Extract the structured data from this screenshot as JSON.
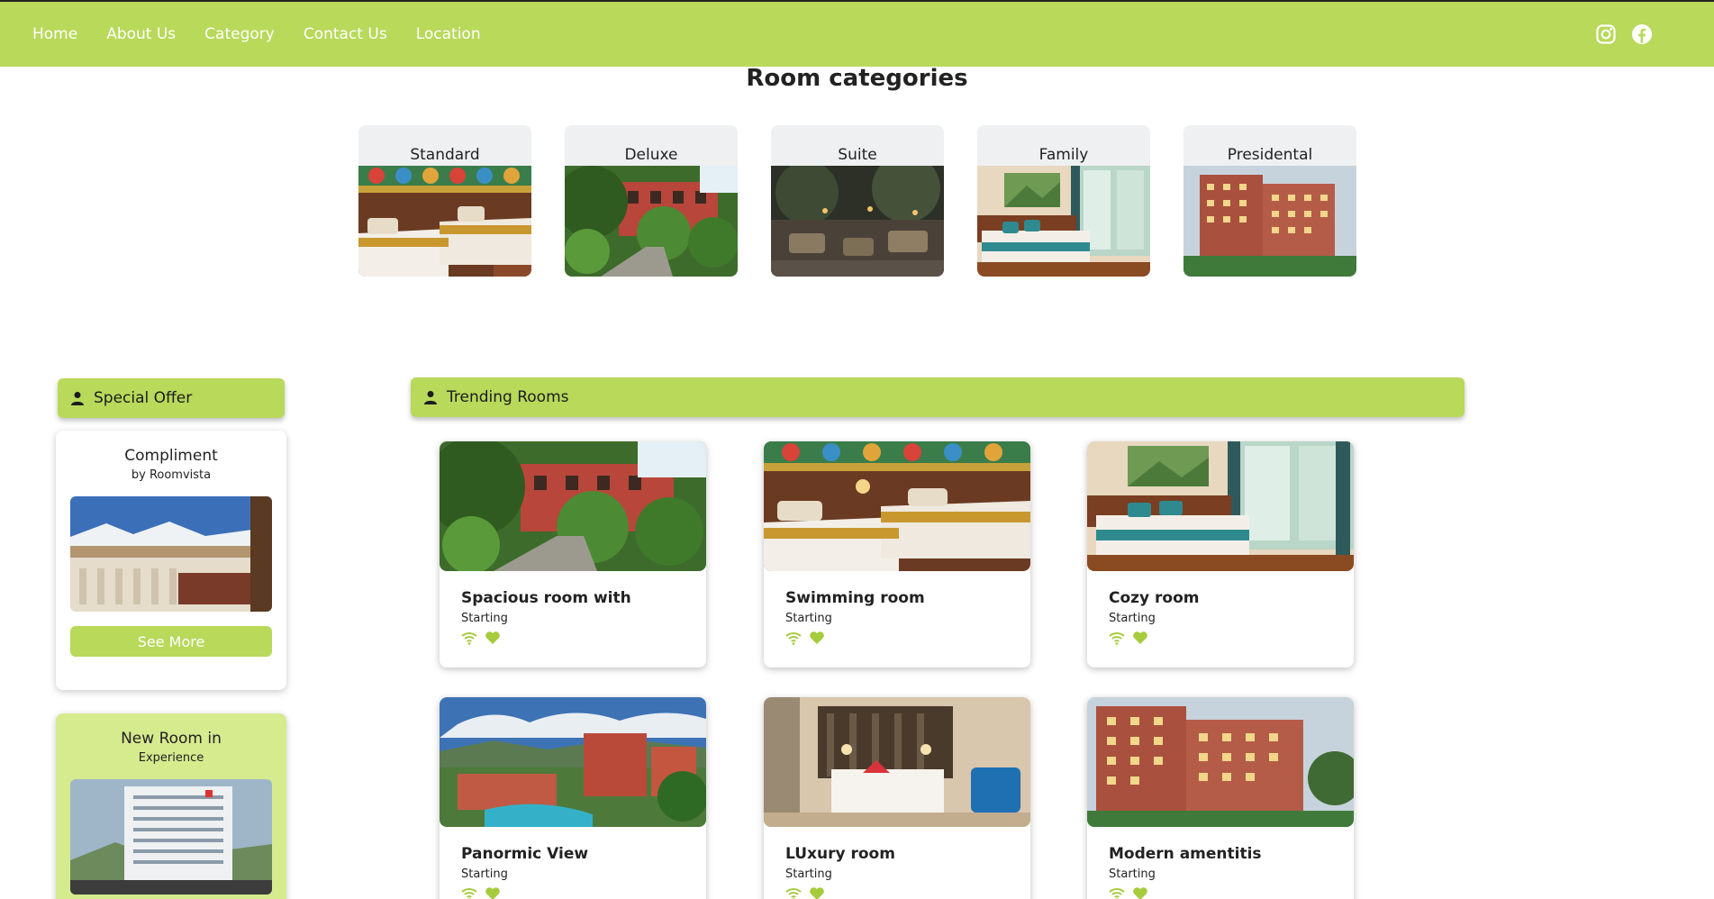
{
  "nav": {
    "items": [
      "Home",
      "About Us",
      "Category",
      "Contact Us",
      "Location"
    ],
    "social": [
      "instagram-icon",
      "facebook-icon"
    ]
  },
  "categories": {
    "title": "Room categories",
    "items": [
      {
        "label": "Standard",
        "image": "hotel-bedroom-photo"
      },
      {
        "label": "Deluxe",
        "image": "garden-courtyard-photo"
      },
      {
        "label": "Suite",
        "image": "patio-lounge-photo"
      },
      {
        "label": "Family",
        "image": "bright-bedroom-photo"
      },
      {
        "label": "Presidental",
        "image": "brick-hotel-building-photo"
      }
    ]
  },
  "special_offer": {
    "header": "Special Offer",
    "cards": [
      {
        "title": "Compliment",
        "subtitle": "by Roomvista",
        "button": "See More",
        "image": "balcony-mountain-view-photo"
      },
      {
        "title": "New Room in",
        "subtitle": "Experience",
        "image": "modern-hotel-tower-photo"
      }
    ]
  },
  "trending": {
    "header": "Trending Rooms",
    "rooms": [
      {
        "title": "Spacious room with",
        "subtitle": "Starting",
        "image": "garden-courtyard-photo"
      },
      {
        "title": "Swimming room",
        "subtitle": "Starting",
        "image": "hotel-bedroom-photo"
      },
      {
        "title": "Cozy room",
        "subtitle": "Starting",
        "image": "bright-bedroom-photo"
      },
      {
        "title": "Panormic View",
        "subtitle": "Starting",
        "image": "resort-pool-aerial-photo"
      },
      {
        "title": "LUxury room",
        "subtitle": "Starting",
        "image": "luxury-bedroom-photo"
      },
      {
        "title": "Modern amentitis",
        "subtitle": "Starting",
        "image": "brick-hotel-building-photo"
      }
    ],
    "amenity_icons": [
      "wifi-icon",
      "heart-icon"
    ]
  },
  "colors": {
    "accent": "#b8d95a",
    "accent_light": "#d6ea8e",
    "text": "#1c1c1c"
  }
}
